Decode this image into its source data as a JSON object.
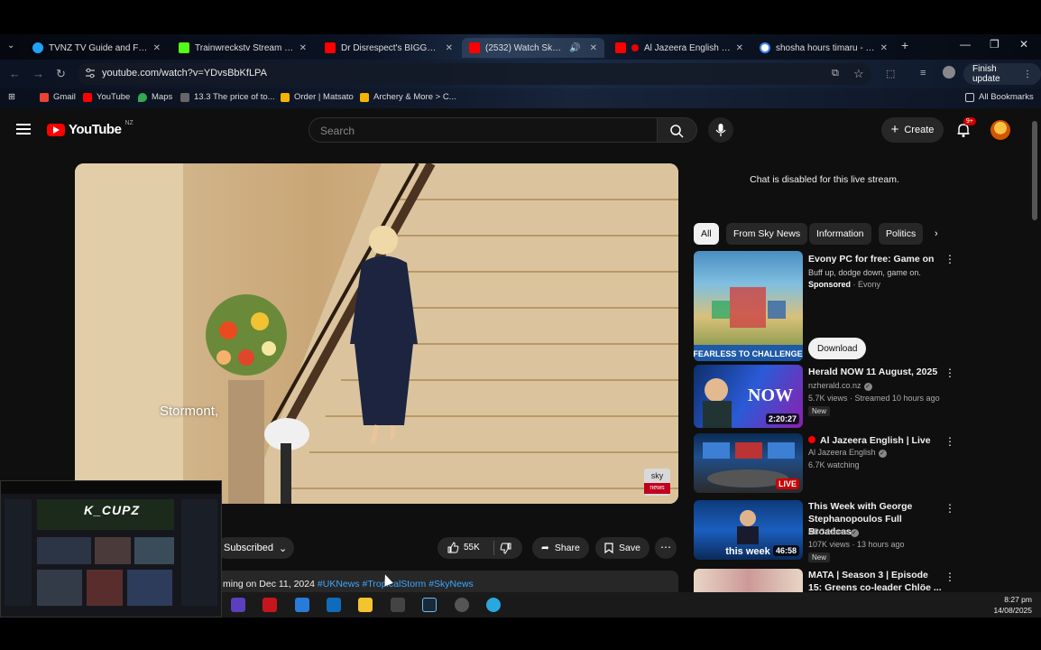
{
  "browser": {
    "tabs": [
      {
        "title": "TVNZ TV Guide and Free Live",
        "color": "#1fa3ff"
      },
      {
        "title": "Trainwreckstv Stream - Watc",
        "color": "#53fc18"
      },
      {
        "title": "Dr Disrespect's BIGGEST An",
        "color": "#ff0000"
      },
      {
        "title": "(2532) Watch Sky News",
        "color": "#ff0000"
      },
      {
        "title": "Al Jazeera English | Live",
        "color": "#ff0000"
      },
      {
        "title": "shosha hours timaru - Goog",
        "color": "#4285f4"
      }
    ],
    "url": "youtube.com/watch?v=YDvsBbKfLPA",
    "finish_update": "Finish update",
    "bookmarks": [
      {
        "label": "Gmail",
        "color": "#ea4335"
      },
      {
        "label": "YouTube",
        "color": "#ff0000"
      },
      {
        "label": "Maps",
        "color": "#34a853"
      },
      {
        "label": "13.3 The price of to...",
        "color": "#888888"
      },
      {
        "label": "Order | Matsato",
        "color": "#f4b400"
      },
      {
        "label": "Archery & More > C...",
        "color": "#f4b400"
      }
    ],
    "all_bookmarks": "All Bookmarks"
  },
  "youtube": {
    "logo_text": "YouTube",
    "country": "NZ",
    "search_placeholder": "Search",
    "create_label": "Create",
    "notif_badge": "9+",
    "video": {
      "caption": "Stormont,",
      "sky_logo": "sky",
      "sky_news": "news"
    },
    "subscribed_label": "Subscribed",
    "likes": "55K",
    "share_label": "Share",
    "save_label": "Save",
    "description": {
      "text": "ming on Dec 11, 2024",
      "tags": "#UKNews #TropicalStorm #SkyNews"
    },
    "chat_disabled": "Chat is disabled for this live stream.",
    "chips": [
      "All",
      "From Sky News",
      "Information",
      "Politics"
    ],
    "recommendations": [
      {
        "title": "Evony PC for free: Game on",
        "subtitle": "Buff up, dodge down, game on.",
        "sponsored": "Sponsored",
        "channel": "Evony",
        "cta": "Download"
      },
      {
        "title": "Herald NOW 11 August, 2025",
        "channel": "nzherald.co.nz",
        "meta": "5.7K views · Streamed 10 hours ago",
        "badge": "New",
        "duration": "2:20:27"
      },
      {
        "title": "Al Jazeera English | Live",
        "channel": "Al Jazeera English",
        "meta": "6.7K watching",
        "badge": "LIVE"
      },
      {
        "title": "This Week with George Stephanopoulos Full Broadcas...",
        "channel": "ABC News",
        "meta": "107K views · 13 hours ago",
        "badge": "New",
        "duration": "46:58"
      },
      {
        "title": "MATA | Season 3 | Episode 15: Greens co-leader Chlöe ..."
      }
    ]
  },
  "overlay": {
    "logo": "K_CUPZ"
  },
  "taskbar": {
    "time": "8:27 pm",
    "date": "14/08/2025"
  }
}
